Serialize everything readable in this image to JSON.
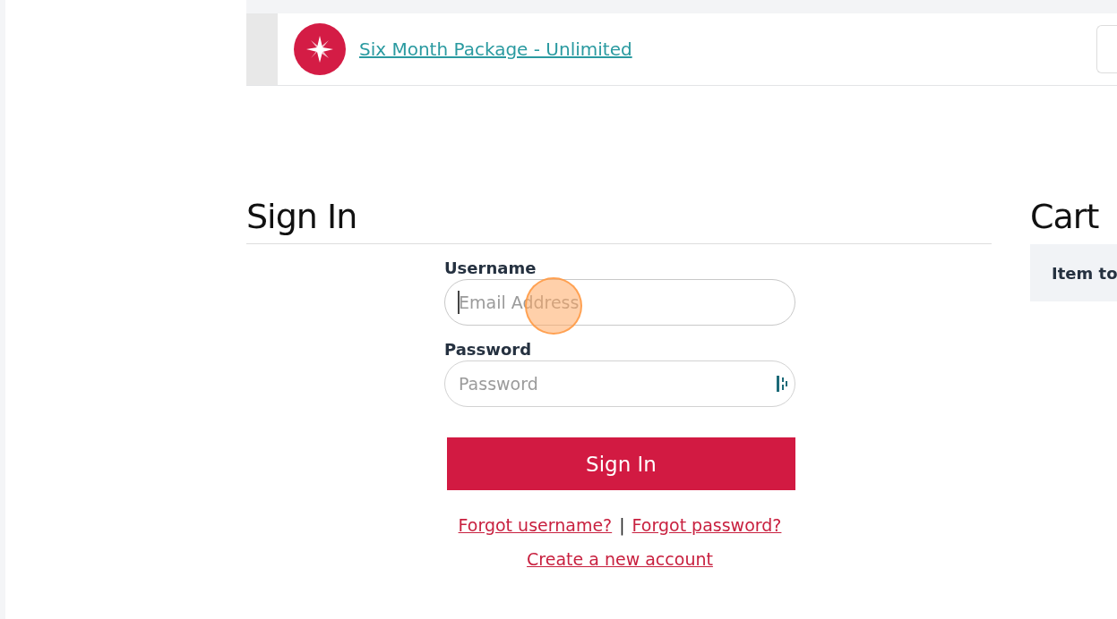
{
  "package_row": {
    "title": "Six Month Package - Unlimited"
  },
  "sign_in": {
    "heading": "Sign In",
    "fields": [
      {
        "label": "Username",
        "placeholder": "Email Address",
        "focused": true,
        "kind": "text"
      },
      {
        "label": "Password",
        "placeholder": "Password",
        "focused": false,
        "kind": "password"
      }
    ],
    "button": "Sign In",
    "links": [
      "Forgot username?",
      "|",
      "Forgot password?"
    ],
    "create_link": "Create a new account"
  },
  "cart": {
    "heading": "Cart",
    "header_cell": "Item to"
  }
}
